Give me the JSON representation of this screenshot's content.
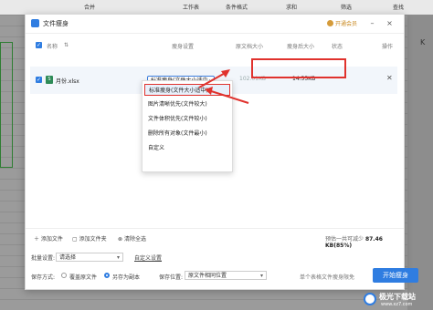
{
  "background": {
    "toolbar_items": [
      "合并",
      "工作表",
      "条件格式",
      "求和",
      "筛选",
      "查找"
    ],
    "column_label": "K"
  },
  "dialog": {
    "title": "文件瘦身",
    "vip_label": "开通会员",
    "columns": {
      "name": "名称",
      "sort": "⇅",
      "setting": "瘦身设置",
      "original_size": "原文档大小",
      "slim_size": "瘦身后大小",
      "status": "状态",
      "action": "操作"
    },
    "file": {
      "name": "月份.xlsx",
      "setting_value": "标准瘦身(文件大小适中",
      "original_size": "102.01KB",
      "slim_size": "14.55KB"
    },
    "dropdown_options": [
      "标准瘦身(文件大小适中)",
      "图片清晰优先(文件较大)",
      "文件体积优先(文件较小)",
      "删除所有对象(文件最小)",
      "自定义"
    ],
    "footer": {
      "add_file": "添加文件",
      "add_folder": "添加文件夹",
      "clear_all": "清除全选",
      "estimate_prefix": "预估一共可减少",
      "estimate_value": "87.46 KB(85%)"
    },
    "batch": {
      "label": "批量设置:",
      "placeholder": "请选择",
      "custom_link": "自定义设置"
    },
    "save_mode": {
      "label": "保存方式:",
      "overwrite": "覆盖原文件",
      "save_copy": "另存为副本"
    },
    "save_location": {
      "label": "保存位置:",
      "value": "原文件相同位置"
    },
    "tip": "单个表格文件瘦身限免",
    "start_button": "开始瘦身"
  },
  "watermark": {
    "text": "极光下载站",
    "url": "www.xz7.com"
  },
  "colors": {
    "accent": "#2f7de1",
    "highlight": "#e0322d"
  }
}
